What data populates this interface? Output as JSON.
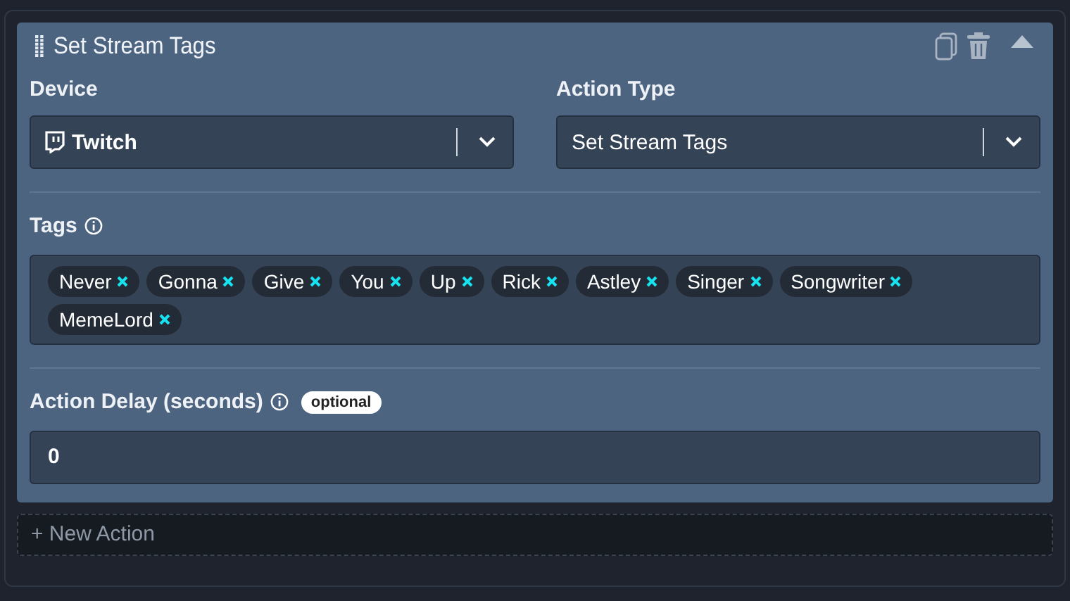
{
  "action": {
    "title": "Set Stream Tags",
    "collapsed": false
  },
  "device": {
    "label": "Device",
    "value": "Twitch"
  },
  "action_type": {
    "label": "Action Type",
    "value": "Set Stream Tags"
  },
  "tags": {
    "label": "Tags",
    "items": [
      "Never",
      "Gonna",
      "Give",
      "You",
      "Up",
      "Rick",
      "Astley",
      "Singer",
      "Songwriter",
      "MemeLord"
    ]
  },
  "delay": {
    "label": "Action Delay (seconds)",
    "badge": "optional",
    "value": "0"
  },
  "new_action": "+ New Action"
}
